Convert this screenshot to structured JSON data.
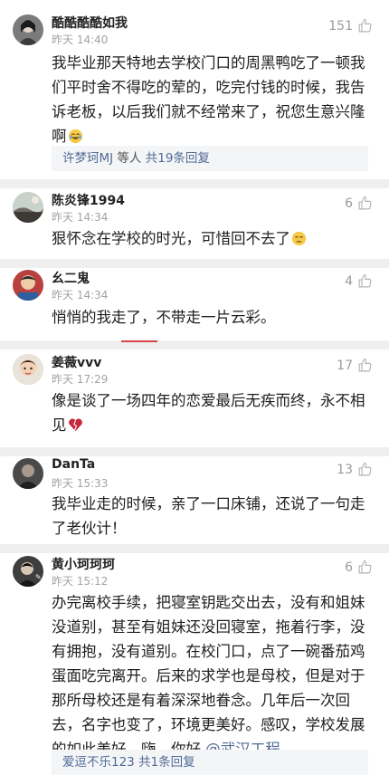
{
  "like_icon": "thumbs-up-icon",
  "comments": [
    {
      "name": "酷酷酷酷如我",
      "time": "昨天 14:40",
      "likes": "151",
      "text": "我毕业那天特地去学校门口的周黑鸭吃了一顿我们平时舍不得吃的荤的，吃完付钱的时候，我告诉老板，以后我们就不经常来了，祝您生意兴隆啊",
      "emoji": "crying-laugh-emoji",
      "reply": {
        "user": "许梦珂MJ",
        "and": " 等人 ",
        "count": "共19条回复"
      }
    },
    {
      "name": "陈炎锋1994",
      "time": "昨天 14:34",
      "likes": "6",
      "text": "狠怀念在学校的时光，可惜回不去了",
      "emoji": "unamused-emoji"
    },
    {
      "name": "幺二鬼",
      "time": "昨天 14:34",
      "likes": "4",
      "text": "悄悄的我走了，不带走一片云彩。"
    },
    {
      "name": "姜薇vvv",
      "time": "昨天 17:29",
      "likes": "17",
      "text": "像是谈了一场四年的恋爱最后无疾而终，永不相见",
      "emoji": "broken-heart-emoji"
    },
    {
      "name": "DanTa",
      "time": "昨天 15:33",
      "likes": "13",
      "text": "我毕业走的时候，亲了一口床铺，还说了一句走了老伙计！"
    },
    {
      "name": "黄小珂珂珂",
      "time": "昨天 15:12",
      "likes": "6",
      "text": "办完离校手续，把寝室钥匙交出去，没有和姐妹没道别，甚至有姐妹还没回寝室，拖着行李，没有拥抱，没有道别。在校门口，点了一碗番茄鸡蛋面吃完离开。后来的求学也是母校，但是对于那所母校还是有着深深地眷念。几年后一次回去，名字也变了，环境更美好。感叹，学校发展的如此美好。嗨，你好 ",
      "mention": "@武汉工程",
      "reply": {
        "user": "爱逗不乐123",
        "and": " ",
        "count": "共1条回复"
      }
    }
  ]
}
